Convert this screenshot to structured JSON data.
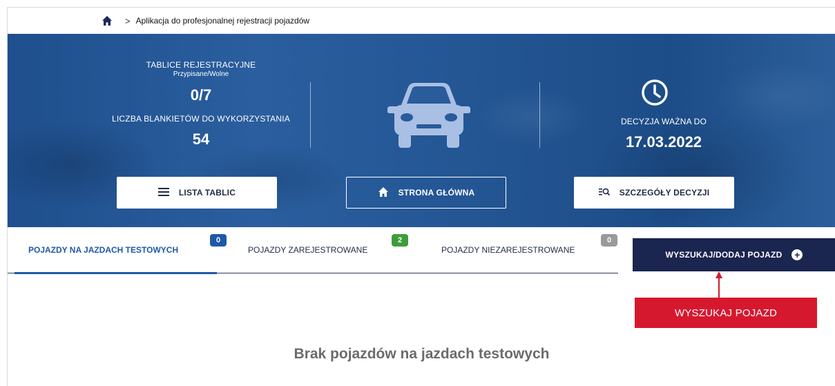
{
  "breadcrumb": {
    "home_icon": "home-icon",
    "separator": ">",
    "current": "Aplikacja do profesjonalnej rejestracji pojazdów"
  },
  "hero": {
    "plates_label": "TABLICE REJESTRACYJNE",
    "plates_sub": "Przypisane/Wolne",
    "plates_value": "0/7",
    "blanks_label": "LICZBA BLANKIETÓW DO WYKORZYSTANIA",
    "blanks_value": "54",
    "decision_label": "DECYZJA WAŻNA DO",
    "decision_value": "17.03.2022",
    "buttons": {
      "list_label": "LISTA TABLIC",
      "home_label": "STRONA GŁÓWNA",
      "details_label": "SZCZEGÓŁY DECYZJI"
    }
  },
  "tabs": [
    {
      "label": "POJAZDY NA JAZDACH TESTOWYCH",
      "count": "0",
      "active": true
    },
    {
      "label": "POJAZDY ZAREJESTROWANE",
      "count": "2",
      "active": false
    },
    {
      "label": "POJAZDY NIEZAREJESTROWANE",
      "count": "0",
      "active": false
    }
  ],
  "search_button": {
    "label": "WYSZUKAJ/DODAJ POJAZD"
  },
  "annotation": {
    "label": "WYSZUKAJ POJAZD"
  },
  "empty_message": "Brak pojazdów na jazdach testowych",
  "colors": {
    "hero_blue": "#245694",
    "accent_blue": "#1e58a8",
    "navy": "#1a2550",
    "badge_green": "#3e9d3b",
    "badge_gray": "#9a9a9a",
    "annotation_red": "#d6182e"
  }
}
